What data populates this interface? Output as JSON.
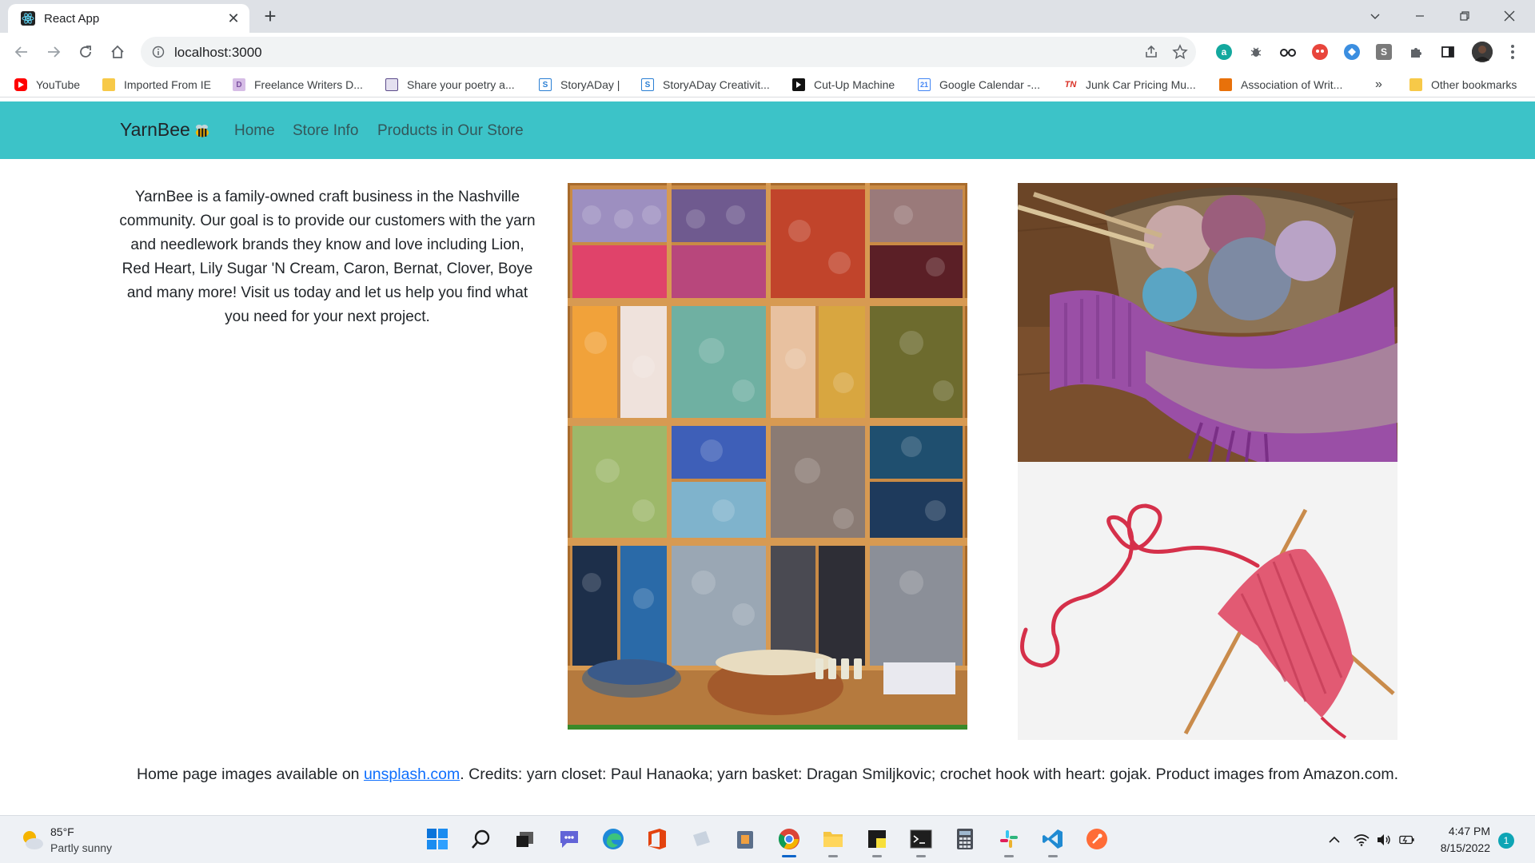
{
  "browser": {
    "tab_title": "React App",
    "url": "localhost:3000",
    "new_tab_label": "+",
    "close_label": "✕"
  },
  "bookmarks": [
    {
      "label": "YouTube",
      "icon": "youtube-icon",
      "color": "#ff0000"
    },
    {
      "label": "Imported From IE",
      "icon": "folder-icon",
      "color": "#f7c948"
    },
    {
      "label": "Freelance Writers D...",
      "icon": "d-icon",
      "color": "#7b4fa0"
    },
    {
      "label": "Share your poetry a...",
      "icon": "book-icon",
      "color": "#5b4b8a"
    },
    {
      "label": "StoryADay |",
      "icon": "s-icon",
      "color": "#2a7fd4"
    },
    {
      "label": "StoryADay Creativit...",
      "icon": "s-icon",
      "color": "#2a7fd4"
    },
    {
      "label": "Cut-Up Machine",
      "icon": "arrow-icon",
      "color": "#111111"
    },
    {
      "label": "Google Calendar -...",
      "icon": "calendar-icon",
      "color": "#4285f4"
    },
    {
      "label": "Junk Car Pricing Mu...",
      "icon": "tn-icon",
      "color": "#d93025"
    },
    {
      "label": "Association of Writ...",
      "icon": "doc-icon",
      "color": "#e8710a"
    }
  ],
  "bookmarks_overflow": "»",
  "other_bookmarks": "Other bookmarks",
  "app": {
    "brand": "YarnBee",
    "nav_links": [
      "Home",
      "Store Info",
      "Products in Our Store"
    ],
    "intro": "YarnBee is a family-owned craft business in the Nashville community. Our goal is to provide our customers with the yarn and needlework brands they know and love including Lion, Red Heart, Lily Sugar 'N Cream, Caron, Bernat, Clover, Boye and many more! Visit us today and let us help you find what you need for your next project.",
    "credits_prefix": "Home page images available on ",
    "credits_link": "unsplash.com",
    "credits_suffix": ". Credits: yarn closet: Paul Hanaoka; yarn basket: Dragan Smiljkovic; crochet hook with heart: gojak. Product images from Amazon.com.",
    "accent_color": "#3cc3c8"
  },
  "taskbar": {
    "temperature": "85°F",
    "condition": "Partly sunny",
    "time": "4:47 PM",
    "date": "8/15/2022",
    "notification_count": "1"
  }
}
